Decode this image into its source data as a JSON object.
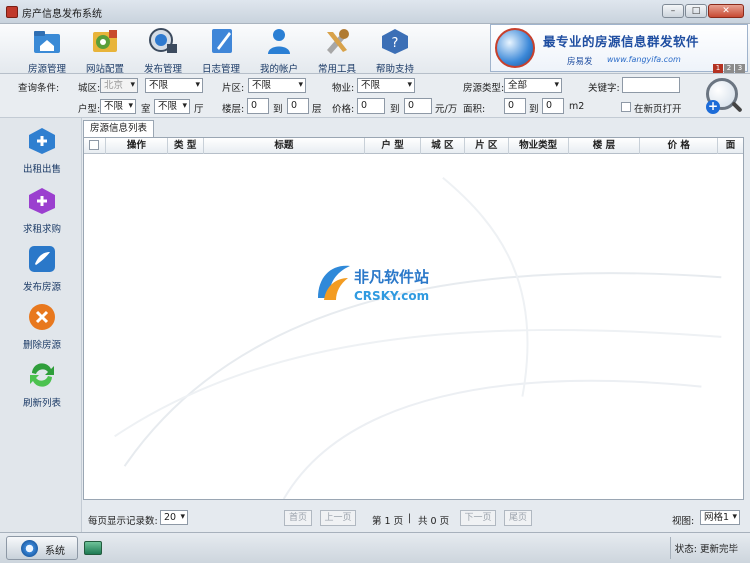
{
  "window": {
    "title": "房产信息发布系统",
    "controls": [
      "–",
      "□",
      "✕"
    ]
  },
  "toolbar": [
    {
      "label": "房源管理",
      "icon": "home-folder-icon",
      "color": "#3a8ad6"
    },
    {
      "label": "网站配置",
      "icon": "web-config-icon",
      "color": "#6b8e23"
    },
    {
      "label": "发布管理",
      "icon": "publish-monitor-icon",
      "color": "#5a6b82"
    },
    {
      "label": "日志管理",
      "icon": "log-book-icon",
      "color": "#2f7acf"
    },
    {
      "label": "我的帐户",
      "icon": "user-account-icon",
      "color": "#2a7fd4"
    },
    {
      "label": "常用工具",
      "icon": "tools-icon",
      "color": "#b07b32"
    },
    {
      "label": "帮助支持",
      "icon": "help-icon",
      "color": "#3b6fb6"
    }
  ],
  "banner": {
    "slogan": "最专业的房源信息群发软件",
    "brand": "房易发",
    "url": "www.fangyifa.com",
    "pages": [
      "1",
      "2",
      "3"
    ]
  },
  "filters": {
    "query_label": "查询条件:",
    "city_label": "城区:",
    "city_value": "北京",
    "district_value": "不限",
    "area_label": "片区:",
    "area_value": "不限",
    "property_label": "物业:",
    "property_value": "不限",
    "source_type_label": "房源类型:",
    "source_type_value": "全部",
    "keyword_label": "关键字:",
    "keyword_value": "",
    "layout_label": "户型:",
    "rooms_value": "不限",
    "room_unit": "室",
    "halls_value": "不限",
    "hall_unit": "厅",
    "floor_label": "楼层:",
    "floor_from": "0",
    "floor_to_label": "到",
    "floor_to": "0",
    "floor_unit": "层",
    "price_label": "价格:",
    "price_from": "0",
    "price_to_label": "到",
    "price_to": "0",
    "price_unit": "元/万",
    "size_label": "面积:",
    "size_from": "0",
    "size_to_label": "到",
    "size_to": "0",
    "size_unit": "m2",
    "new_page_label": "在新页打开"
  },
  "sidebar": [
    {
      "label": "出租出售",
      "icon": "rent-sell-icon",
      "color": "#2f7fd0"
    },
    {
      "label": "求租求购",
      "icon": "seek-rent-buy-icon",
      "color": "#9b3fcf"
    },
    {
      "label": "发布房源",
      "icon": "publish-listing-icon",
      "color": "#2a78c9"
    },
    {
      "label": "删除房源",
      "icon": "delete-listing-icon",
      "color": "#e8781e"
    },
    {
      "label": "刷新列表",
      "icon": "refresh-list-icon",
      "color": "#2f9e3b"
    }
  ],
  "tab": {
    "label": "房源信息列表"
  },
  "grid": {
    "columns": [
      "操作",
      "类 型",
      "标题",
      "户 型",
      "城 区",
      "片 区",
      "物业类型",
      "楼 层",
      "价 格",
      "面"
    ]
  },
  "watermark": {
    "text": "非凡软件站",
    "subtext": "CRSKY.com"
  },
  "paging": {
    "per_page_label": "每页显示记录数:",
    "per_page_value": "20",
    "first": "首页",
    "prev": "上一页",
    "current": "第 1 页",
    "sep": "|",
    "total": "共 0 页",
    "next": "下一页",
    "last": "尾页",
    "view_label": "视图:",
    "view_value": "网格1"
  },
  "statusbar": {
    "system_label": "系统",
    "status_text": "状态: 更新完毕"
  }
}
